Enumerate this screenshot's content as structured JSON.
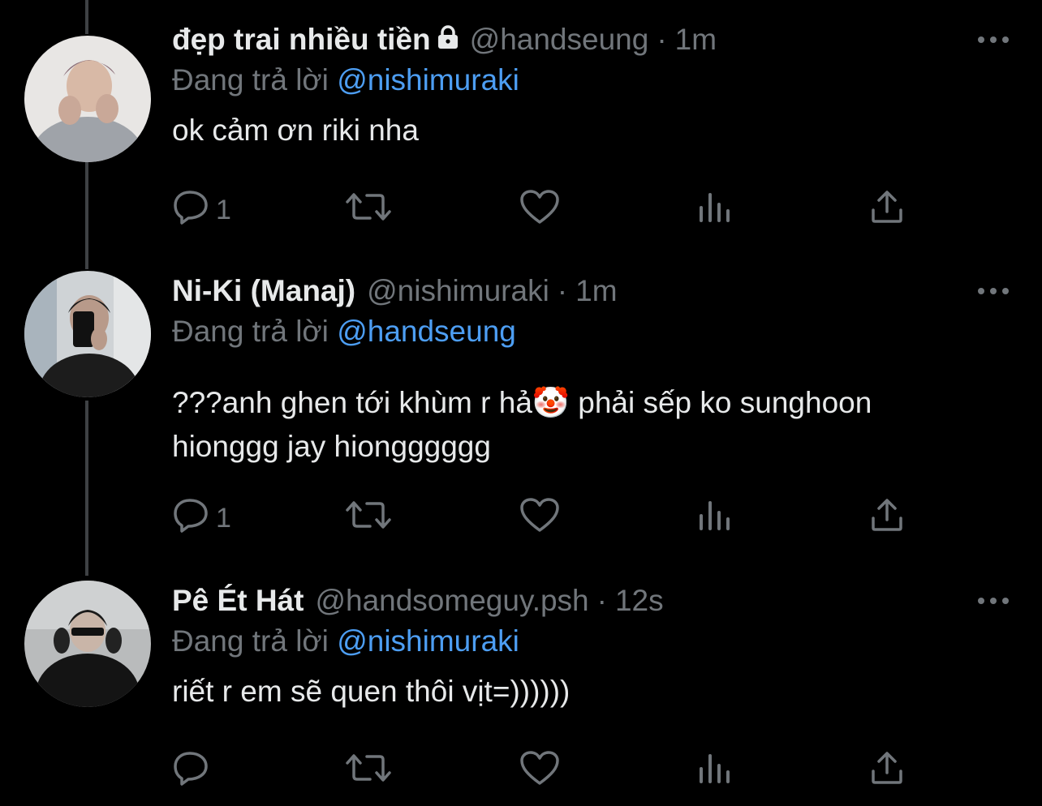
{
  "tweets": [
    {
      "display_name": "đẹp trai nhiều tiền",
      "protected": true,
      "handle": "@handseung",
      "separator": "·",
      "time": "1m",
      "reply_prefix": "Đang trả lời",
      "reply_to": "@nishimuraki",
      "text": "ok cảm ơn riki nha",
      "reply_count": "1",
      "avatar": "avatar-handseung"
    },
    {
      "display_name": "Ni-Ki (Manaj)",
      "protected": false,
      "handle": "@nishimuraki",
      "separator": "·",
      "time": "1m",
      "reply_prefix": "Đang trả lời",
      "reply_to": "@handseung",
      "text_line1": "???anh ghen tới khùm r hả🤡 phải sếp ko sunghoon",
      "text_line2": "hionggg jay hiongggggg",
      "reply_count": "1",
      "avatar": "avatar-nishimuraki"
    },
    {
      "display_name": "Pê Ét Hát",
      "protected": false,
      "handle": "@handsomeguy.psh",
      "separator": "·",
      "time": "12s",
      "reply_prefix": "Đang trả lời",
      "reply_to": "@nishimuraki",
      "text": "riết r em sẽ quen thôi vịt=))))))",
      "reply_count": "",
      "avatar": "avatar-handsomeguy"
    }
  ],
  "icons": {
    "reply": "reply-icon",
    "retweet": "retweet-icon",
    "like": "heart-icon",
    "views": "views-icon",
    "share": "share-icon",
    "more": "more-icon",
    "lock": "lock-icon"
  },
  "colors": {
    "background": "#000000",
    "text": "#e7e9ea",
    "secondary": "#71767b",
    "mention": "#4d9ef3",
    "thread_line": "#3e4144"
  }
}
